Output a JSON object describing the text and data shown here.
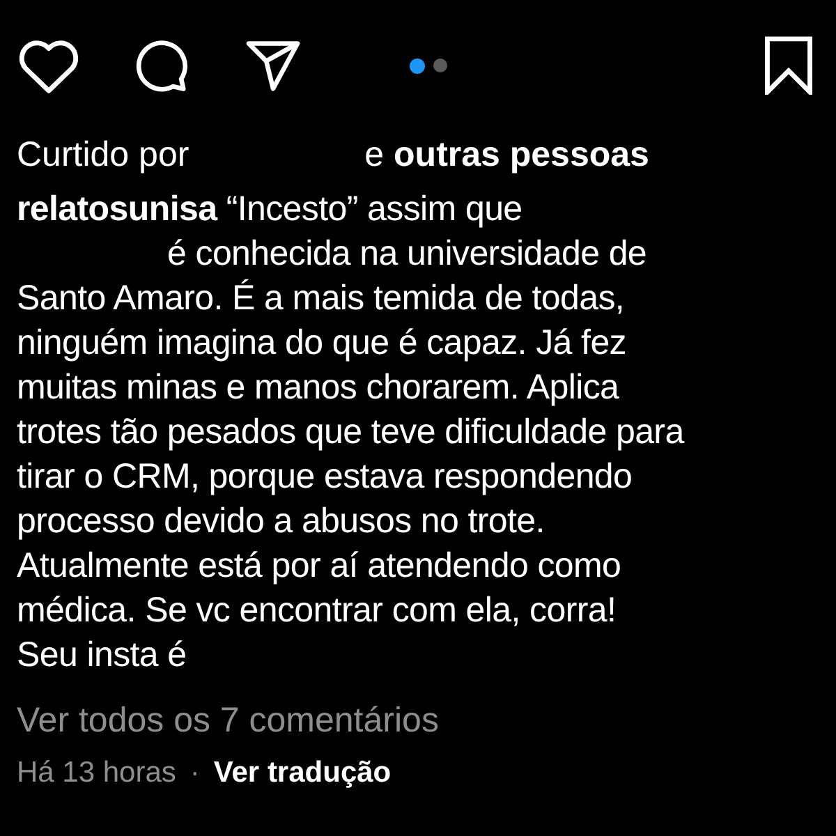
{
  "carousel_dots": [
    {
      "selected": true
    },
    {
      "selected": false
    }
  ],
  "liked_by": {
    "prefix": "Curtido por",
    "redacted_name": true,
    "suffix": "e **outras pessoas**"
  },
  "caption_lines": [
    {
      "text": "**relatosunisa** “Incesto” assim que",
      "redacted_before": false
    },
    {
      "text": "é conhecida na universidade de",
      "redacted_before": true
    },
    {
      "text": "Santo Amaro. É a mais temida de todas,",
      "redacted_before": false
    },
    {
      "text": "ninguém imagina do que é capaz. Já fez",
      "redacted_before": false
    },
    {
      "text": "muitas minas e manos chorarem. Aplica",
      "redacted_before": false
    },
    {
      "text": "trotes tão pesados que teve dificuldade para",
      "redacted_before": false
    },
    {
      "text": "tirar o CRM, porque estava respondendo",
      "redacted_before": false
    },
    {
      "text": "processo devido a abusos no trote.",
      "redacted_before": false
    },
    {
      "text": "Atualmente está por aí atendendo como",
      "redacted_before": false
    },
    {
      "text": "médica. Se vc encontrar com ela, corra!",
      "redacted_before": false
    },
    {
      "text": "Seu insta é",
      "redacted_before": false
    }
  ],
  "view_comments": "Ver todos os 7 comentários",
  "timestamp": "Há 13 horas",
  "separator": "·",
  "translate_link": "Ver tradução"
}
